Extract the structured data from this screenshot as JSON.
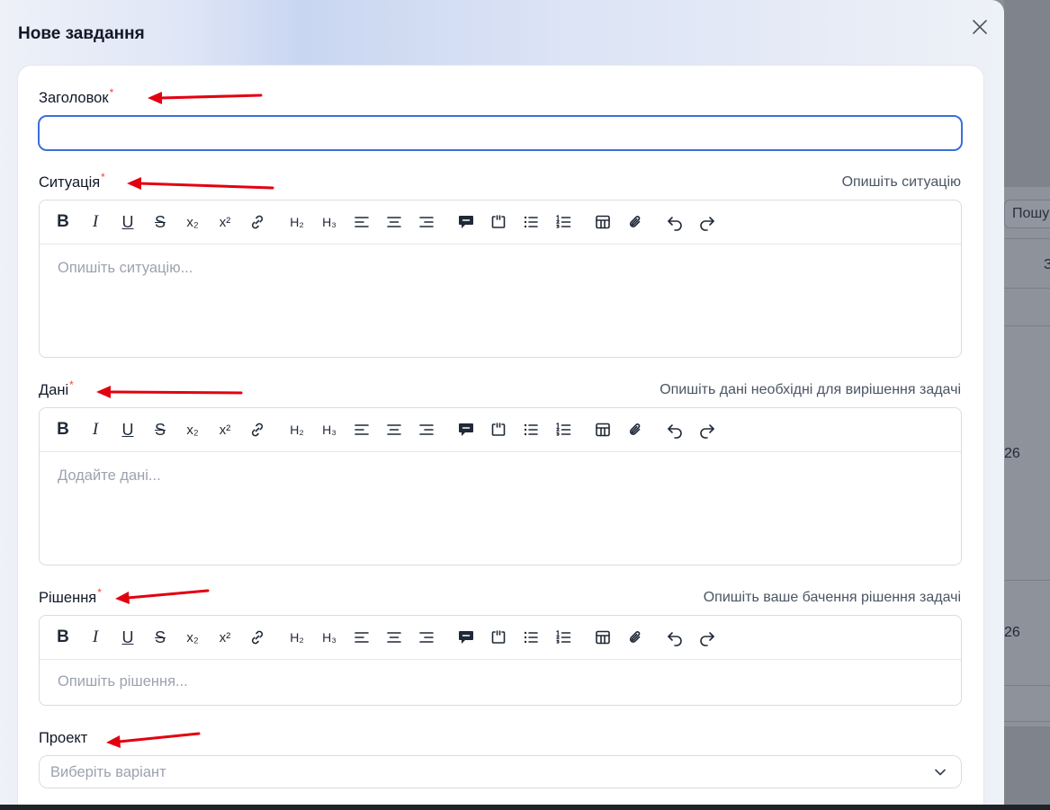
{
  "modal": {
    "title": "Нове завдання",
    "close_icon": "close-icon"
  },
  "fields": {
    "title": {
      "label": "Заголовок",
      "required_mark": "*",
      "value": ""
    },
    "situation": {
      "label": "Ситуація",
      "required_mark": "*",
      "hint": "Опишіть ситуацію",
      "placeholder": "Опишіть ситуацію..."
    },
    "data": {
      "label": "Дані",
      "required_mark": "*",
      "hint": "Опишіть дані необхідні для вирішення задачі",
      "placeholder": "Додайте дані..."
    },
    "solution": {
      "label": "Рішення",
      "required_mark": "*",
      "hint": "Опишіть ваше бачення рішення задачі",
      "placeholder": "Опишіть рішення..."
    },
    "project": {
      "label": "Проект",
      "placeholder": "Виберіть варіант"
    }
  },
  "toolbar": {
    "bold": "B",
    "italic": "I",
    "underline": "U",
    "strike": "S",
    "subscript": "x₂",
    "superscript": "x²",
    "h2": "H₂",
    "h3": "H₃"
  },
  "background": {
    "search_text": "Пошу",
    "cell_a": "З",
    "cell_b": "26",
    "cell_c": "26"
  },
  "colors": {
    "accent": "#3b6fd8",
    "required": "#ef4444",
    "annotation_arrow": "#e3000f"
  }
}
